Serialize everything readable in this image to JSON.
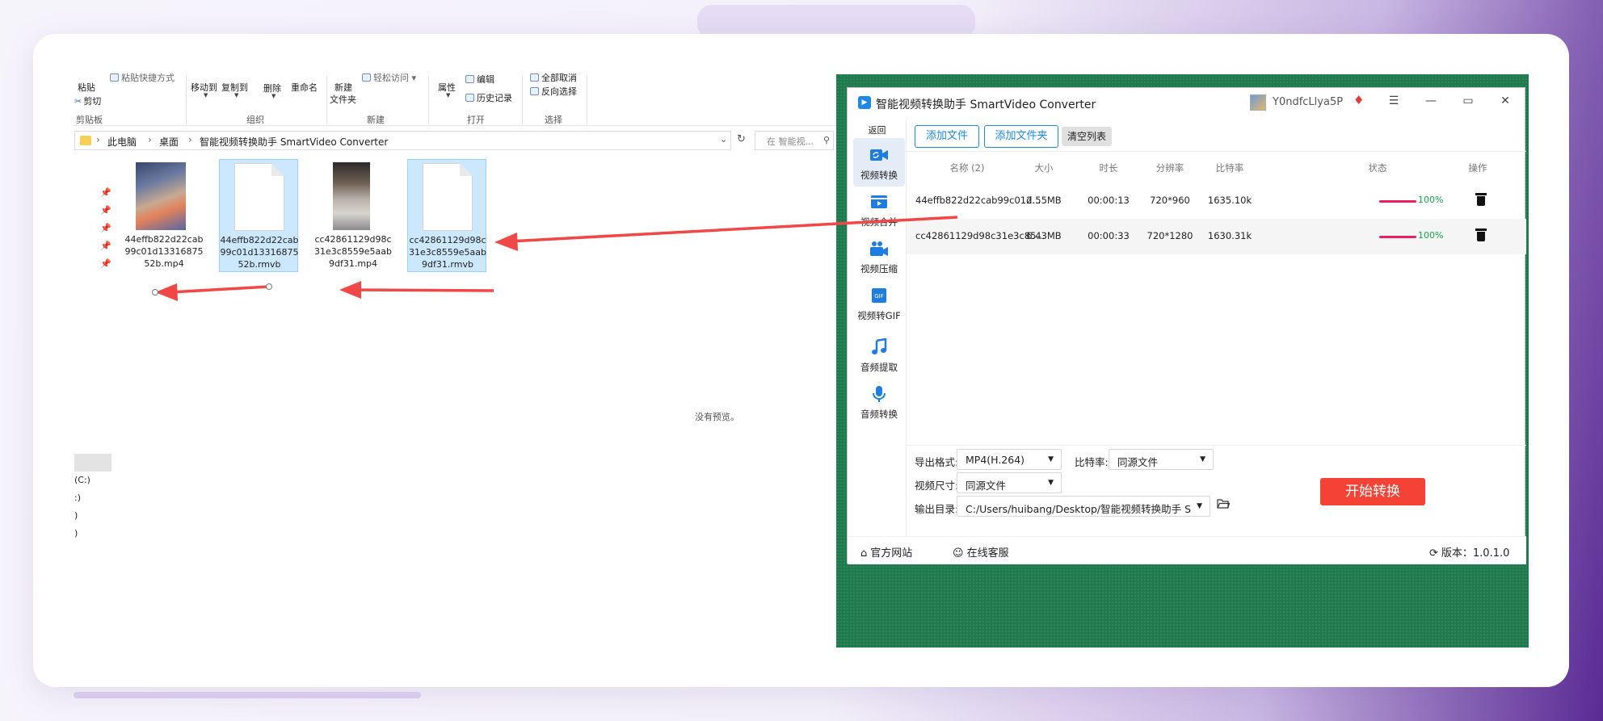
{
  "explorer": {
    "ribbon": {
      "paste": "粘贴",
      "paste_path": "粘贴快捷方式",
      "cut": "剪切",
      "clipboard_group": "剪贴板",
      "move_to": "移动到",
      "copy_to": "复制到",
      "delete": "删除",
      "rename": "重命名",
      "organize_group": "组织",
      "new_folder_line1": "新建",
      "new_folder_line2": "文件夹",
      "easy_access": "轻松访问",
      "new_group": "新建",
      "properties": "属性",
      "edit": "编辑",
      "history": "历史记录",
      "open_group": "打开",
      "select_all": "全部取消",
      "invert": "反向选择",
      "select_group": "选择"
    },
    "breadcrumb": [
      "此电脑",
      "桌面",
      "智能视频转换助手 SmartVideo Converter"
    ],
    "search_placeholder": "在 智能视...",
    "files": [
      {
        "name": "44effb822d22cab99c01d1331687552b.mp4"
      },
      {
        "name": "44effb822d22cab99c01d1331687552b.rmvb"
      },
      {
        "name": "cc42861129d98c31e3c8559e5aab9df31.mp4"
      },
      {
        "name": "cc42861129d98c31e3c8559e5aab9df31.rmvb"
      }
    ],
    "no_preview": "没有预览。",
    "drives": [
      "(C:)",
      ":)",
      ")",
      ")"
    ]
  },
  "app": {
    "title": "智能视频转换助手 SmartVideo Converter",
    "username": "Y0ndfcLlya5P",
    "window_controls": {
      "menu": "☰",
      "minimize": "—",
      "maximize": "▭",
      "close": "✕"
    },
    "back": "返回",
    "nav": [
      {
        "label": "视频转换",
        "icon": "video-convert-icon"
      },
      {
        "label": "视频合并",
        "icon": "video-merge-icon"
      },
      {
        "label": "视频压缩",
        "icon": "video-compress-icon"
      },
      {
        "label": "视频转GIF",
        "icon": "gif-icon"
      },
      {
        "label": "音频提取",
        "icon": "music-note-icon"
      },
      {
        "label": "音频转换",
        "icon": "microphone-icon"
      }
    ],
    "toolbar": {
      "add_file": "添加文件",
      "add_folder": "添加文件夹",
      "clear_list": "清空列表"
    },
    "table": {
      "headers": [
        "名称 (2)",
        "大小",
        "时长",
        "分辨率",
        "比特率",
        "状态",
        "操作"
      ],
      "rows": [
        {
          "name": "44effb822d22cab99c01d...",
          "size": "2.55MB",
          "duration": "00:00:13",
          "resolution": "720*960",
          "bitrate": "1635.10k",
          "progress": "100%"
        },
        {
          "name": "cc42861129d98c31e3c85...",
          "size": "6.43MB",
          "duration": "00:00:33",
          "resolution": "720*1280",
          "bitrate": "1630.31k",
          "progress": "100%"
        }
      ]
    },
    "settings": {
      "format_label": "导出格式:",
      "format_value": "MP4(H.264)",
      "bitrate_label": "比特率:",
      "bitrate_value": "同源文件",
      "size_label": "视频尺寸:",
      "size_value": "同源文件",
      "output_label": "输出目录:",
      "output_value": "C:/Users/huibang/Desktop/智能视频转换助手 SmartVideo"
    },
    "start_button": "开始转换",
    "footer": {
      "website": "官方网站",
      "support": "在线客服",
      "version": "版本：1.0.1.0"
    }
  },
  "colors": {
    "accent": "#1e88e5",
    "start": "#f44336",
    "progress": "#e91e63",
    "green_bg": "#1f7a4e",
    "arrow": "#f04747"
  }
}
